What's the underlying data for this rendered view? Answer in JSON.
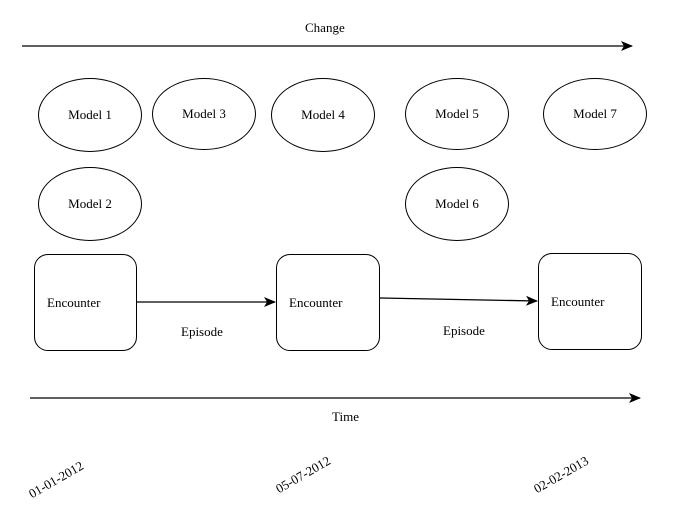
{
  "change_axis": {
    "label": "Change"
  },
  "time_axis": {
    "label": "Time"
  },
  "models": [
    {
      "label": "Model 1"
    },
    {
      "label": "Model 2"
    },
    {
      "label": "Model 3"
    },
    {
      "label": "Model 4"
    },
    {
      "label": "Model 5"
    },
    {
      "label": "Model 6"
    },
    {
      "label": "Model 7"
    }
  ],
  "encounters": [
    {
      "label": "Encounter"
    },
    {
      "label": "Encounter"
    },
    {
      "label": "Encounter"
    }
  ],
  "episodes": [
    {
      "label": "Episode"
    },
    {
      "label": "Episode"
    }
  ],
  "dates": [
    "01-01-2012",
    "05-07-2012",
    "02-02-2013"
  ]
}
